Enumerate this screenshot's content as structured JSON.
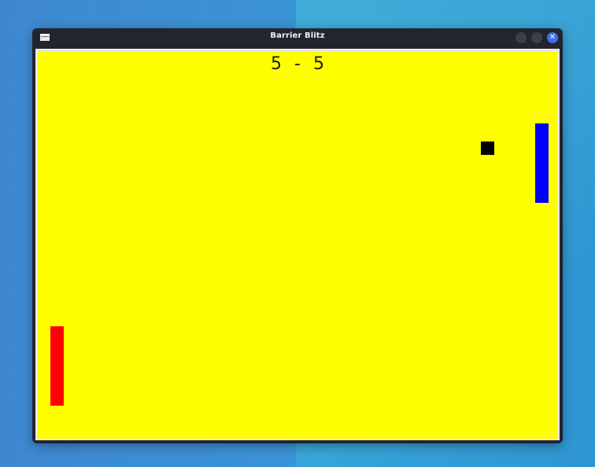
{
  "window": {
    "title": "Barrier Blitz",
    "icon": "window-icon",
    "controls": [
      "minimize-icon",
      "maximize-icon",
      "close-icon"
    ],
    "close_glyph": "✕"
  },
  "game": {
    "score": {
      "left": "5",
      "separator": "-",
      "right": "5"
    },
    "colors": {
      "background": "#ffff00",
      "left_paddle": "#ff0000",
      "right_paddle": "#0000ff",
      "ball": "#000000"
    }
  }
}
